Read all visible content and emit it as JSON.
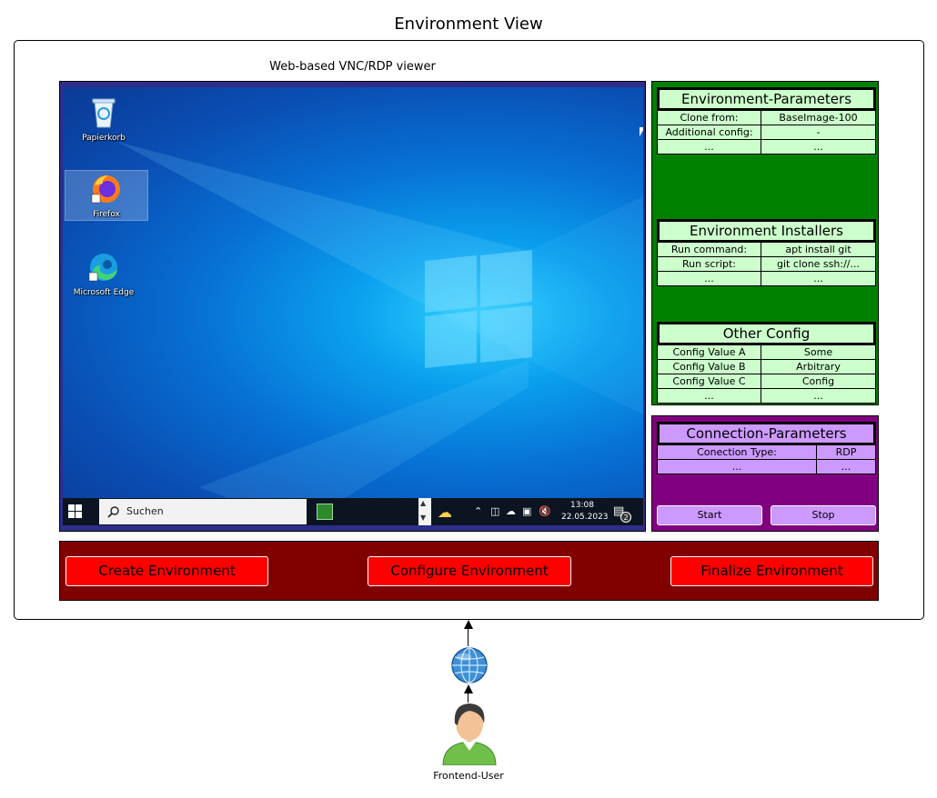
{
  "title": "Environment View",
  "viewer": {
    "label": "Web-based VNC/RDP viewer",
    "desktop_icons": [
      "Papierkorb",
      "Firefox",
      "Microsoft Edge"
    ],
    "taskbar": {
      "search_placeholder": "Suchen",
      "time": "13:08",
      "date": "22.05.2023",
      "notification_count": "2"
    }
  },
  "env_parameters": {
    "title": "Environment-Parameters",
    "rows": [
      {
        "key": "Clone from:",
        "value": "BaseImage-100"
      },
      {
        "key": "Additional config:",
        "value": "-"
      },
      {
        "key": "...",
        "value": "..."
      }
    ]
  },
  "env_installers": {
    "title": "Environment Installers",
    "rows": [
      {
        "key": "Run command:",
        "value": "apt install git"
      },
      {
        "key": "Run script:",
        "value": "git clone ssh://..."
      },
      {
        "key": "...",
        "value": "..."
      }
    ]
  },
  "other_config": {
    "title": "Other Config",
    "rows": [
      {
        "key": "Config Value A",
        "value": "Some"
      },
      {
        "key": "Config Value B",
        "value": "Arbitrary"
      },
      {
        "key": "Config Value C",
        "value": "Config"
      },
      {
        "key": "...",
        "value": "..."
      }
    ]
  },
  "connection": {
    "title": "Connection-Parameters",
    "rows": [
      {
        "key": "Conection Type:",
        "value": "RDP"
      },
      {
        "key": "...",
        "value": "..."
      }
    ],
    "start_label": "Start",
    "stop_label": "Stop"
  },
  "actions": {
    "create": "Create Environment",
    "configure": "Configure Environment",
    "finalize": "Finalize Environment"
  },
  "user_label": "Frontend-User",
  "colors": {
    "env_panel": "#008000",
    "env_table": "#ccffcc",
    "conn_panel": "#800080",
    "conn_table": "#cc99ff",
    "action_bar": "#800000",
    "action_button": "#ff0000"
  },
  "icons": [
    "recycle-bin-icon",
    "firefox-icon",
    "edge-icon",
    "windows-start-icon",
    "search-icon",
    "weather-icon",
    "globe-icon",
    "user-icon"
  ]
}
